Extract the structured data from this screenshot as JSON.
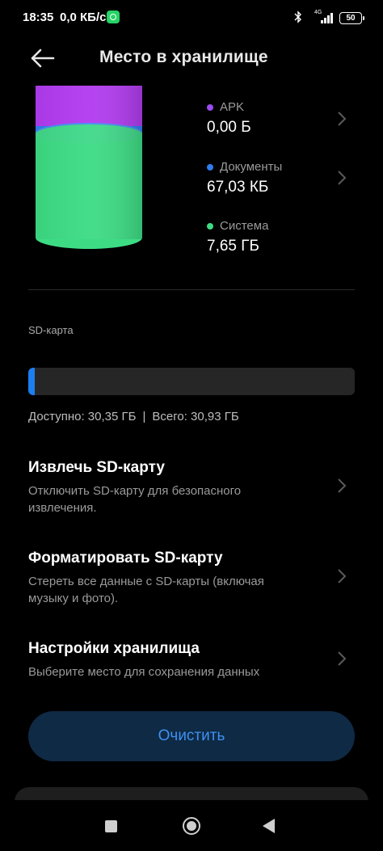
{
  "status_bar": {
    "time": "18:35",
    "speed": "0,0 КБ/с",
    "network_type": "4G",
    "battery": "50",
    "icons": [
      "whatsapp-icon",
      "bluetooth-icon",
      "signal-icon",
      "battery-icon"
    ]
  },
  "header": {
    "title": "Место в хранилище",
    "back_icon": "back-arrow-icon"
  },
  "chart_data": {
    "type": "stacked-cylinder",
    "segments": [
      {
        "name": "APK",
        "color": "#b23cf0"
      },
      {
        "name": "Документы",
        "color": "#2f7df0"
      },
      {
        "name": "Система",
        "color": "#3ddc84"
      }
    ]
  },
  "categories": [
    {
      "name": "APK",
      "value": "0,00 Б",
      "color": "#9a4cf0"
    },
    {
      "name": "Документы",
      "value": "67,03 КБ",
      "color": "#2f7df0"
    },
    {
      "name": "Система",
      "value": "7,65 ГБ",
      "color": "#3ddc84"
    }
  ],
  "sd": {
    "label": "SD-карта",
    "available_text": "Доступно: 30,35 ГБ",
    "separator": "|",
    "total_text": "Всего: 30,93 ГБ",
    "used_fraction": 0.019,
    "bar_color": "#1d7ef0"
  },
  "items": [
    {
      "title": "Извлечь SD-карту",
      "subtitle": "Отключить SD-карту для безопасного извлечения."
    },
    {
      "title": "Форматировать SD-карту",
      "subtitle": "Стереть все данные с SD-карты (включая музыку и фото)."
    },
    {
      "title": "Настройки хранилища",
      "subtitle": "Выберите место для сохранения данных"
    }
  ],
  "clean_button": {
    "label": "Очистить",
    "color": "#3d90f0"
  },
  "nav": {
    "icons": [
      "recents-square-icon",
      "home-circle-icon",
      "back-triangle-icon"
    ]
  }
}
